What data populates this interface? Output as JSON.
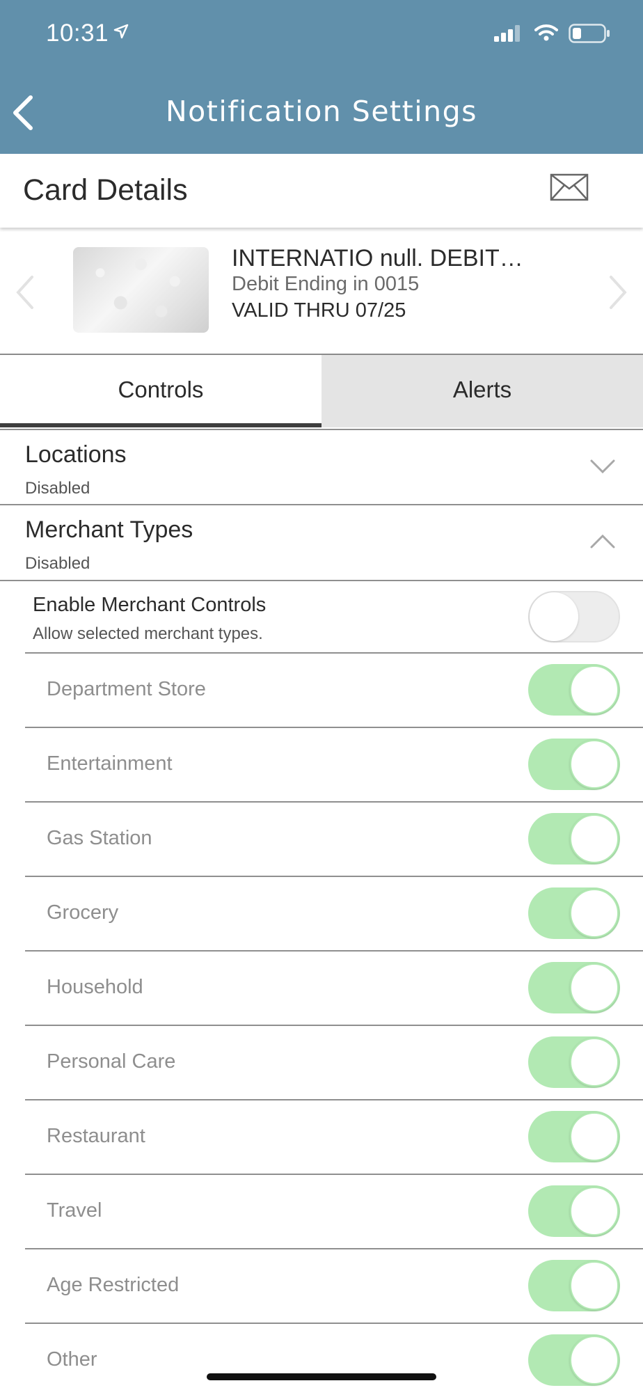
{
  "status_bar": {
    "time": "10:31",
    "icons": [
      "location-arrow-icon",
      "cellular-signal-icon",
      "wifi-icon",
      "battery-icon"
    ]
  },
  "header": {
    "title": "Notification Settings",
    "back_icon": "chevron-left-icon",
    "bg_color": "#6190ab"
  },
  "card_details": {
    "title": "Card Details",
    "mail_icon": "envelope-icon"
  },
  "card": {
    "name": "INTERNATIO null. DEBIT…",
    "ending": "Debit Ending in 0015",
    "valid_thru": "VALID THRU 07/25"
  },
  "tabs": [
    {
      "label": "Controls",
      "active": true
    },
    {
      "label": "Alerts",
      "active": false
    }
  ],
  "sections": {
    "locations": {
      "title": "Locations",
      "status": "Disabled",
      "expanded": false
    },
    "merchant_types": {
      "title": "Merchant Types",
      "status": "Disabled",
      "expanded": true
    }
  },
  "enable_merchant": {
    "title": "Enable Merchant Controls",
    "subtitle": "Allow selected merchant types.",
    "enabled": false
  },
  "merchants": [
    {
      "label": "Department Store",
      "enabled": true
    },
    {
      "label": "Entertainment",
      "enabled": true
    },
    {
      "label": "Gas Station",
      "enabled": true
    },
    {
      "label": "Grocery",
      "enabled": true
    },
    {
      "label": "Household",
      "enabled": true
    },
    {
      "label": "Personal Care",
      "enabled": true
    },
    {
      "label": "Restaurant",
      "enabled": true
    },
    {
      "label": "Travel",
      "enabled": true
    },
    {
      "label": "Age Restricted",
      "enabled": true
    },
    {
      "label": "Other",
      "enabled": true
    }
  ],
  "colors": {
    "toggle_on": "#b2e9b3",
    "toggle_off": "#ededed"
  }
}
